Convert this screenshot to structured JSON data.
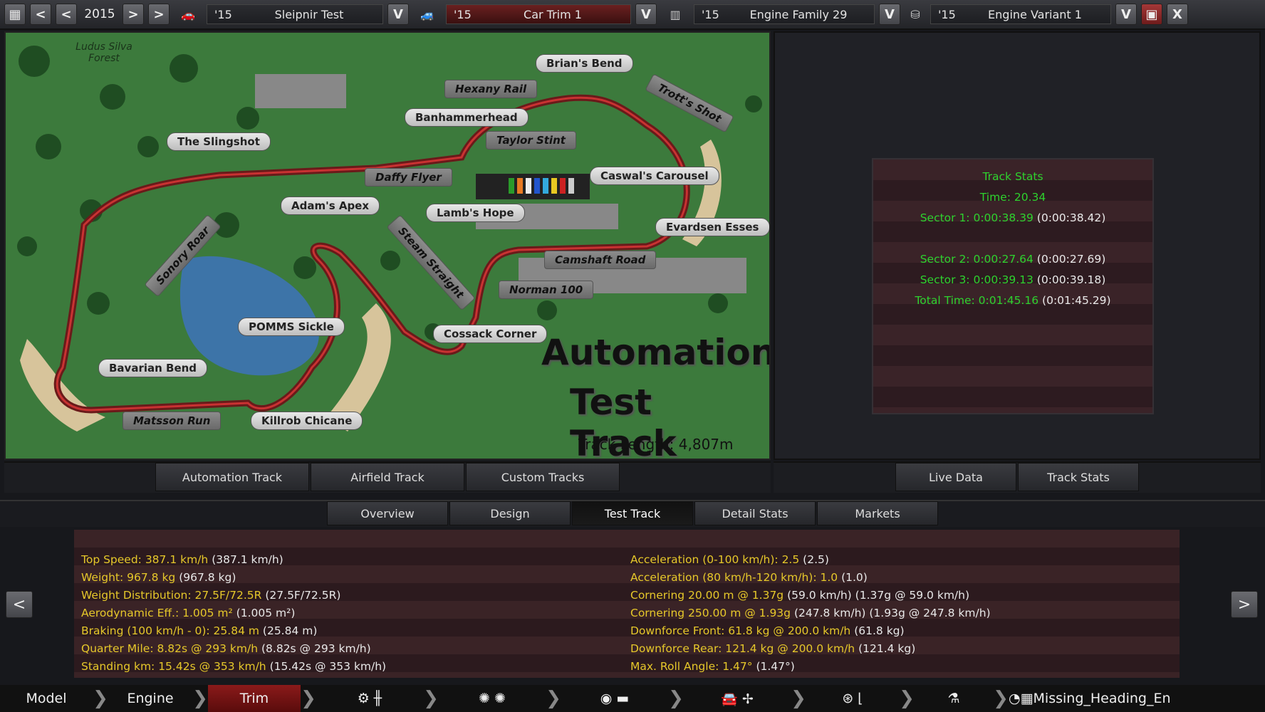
{
  "topbar": {
    "year": "2015",
    "model": {
      "year": "'15",
      "name": "Sleipnir Test"
    },
    "trim": {
      "year": "'15",
      "name": "Car Trim 1"
    },
    "family": {
      "year": "'15",
      "name": "Engine Family 29"
    },
    "variant": {
      "year": "'15",
      "name": "Engine Variant 1"
    },
    "dropdown_glyph": "V",
    "prev_glyph": "<",
    "next_glyph": ">",
    "close_glyph": "X"
  },
  "map": {
    "title_line1": "Automation",
    "title_line2": "Test Track",
    "length": "Track Length: 4,807m",
    "forest": "Ludus Silva Forest",
    "labels": [
      "Brian's Bend",
      "Hexany Rail",
      "Banhammerhead",
      "Trott's Shot",
      "The Slingshot",
      "Taylor Stint",
      "Caswal's Carousel",
      "Daffy Flyer",
      "Adam's Apex",
      "Lamb's Hope",
      "Evardsen Esses",
      "Sonory Roar",
      "Steam Straight",
      "Camshaft Road",
      "Norman 100",
      "POMMS Sickle",
      "Cossack Corner",
      "Bavarian Bend",
      "Matsson Run",
      "Killrob Chicane"
    ]
  },
  "track_tabs": [
    "Automation Track",
    "Airfield Track",
    "Custom Tracks"
  ],
  "right_tabs": [
    "Live Data",
    "Track Stats"
  ],
  "track_stats": {
    "title": "Track Stats",
    "time": "Time: 20.34",
    "sector1": "Sector 1: 0:00:38.39",
    "sector1_pb": "(0:00:38.42)",
    "sector2": "Sector 2: 0:00:27.64",
    "sector2_pb": "(0:00:27.69)",
    "sector3": "Sector 3: 0:00:39.13",
    "sector3_pb": "(0:00:39.18)",
    "total": "Total Time: 0:01:45.16",
    "total_pb": "(0:01:45.29)"
  },
  "sub_tabs": [
    "Overview",
    "Design",
    "Test Track",
    "Detail Stats",
    "Markets"
  ],
  "details_left": [
    {
      "label": "Top Speed: 387.1 km/h",
      "prev": "(387.1 km/h)"
    },
    {
      "label": "Weight: 967.8 kg",
      "prev": "(967.8 kg)"
    },
    {
      "label": "Weight Distribution: 27.5F/72.5R",
      "prev": "(27.5F/72.5R)"
    },
    {
      "label": "Aerodynamic Eff.: 1.005 m²",
      "prev": "(1.005 m²)"
    },
    {
      "label": "Braking (100 km/h - 0): 25.84 m",
      "prev": "(25.84 m)"
    },
    {
      "label": "Quarter Mile: 8.82s @ 293 km/h",
      "prev": "(8.82s @ 293 km/h)"
    },
    {
      "label": "Standing km: 15.42s @ 353 km/h",
      "prev": "(15.42s @ 353 km/h)"
    }
  ],
  "details_right": [
    {
      "label": "Acceleration (0-100 km/h): 2.5",
      "prev": "(2.5)"
    },
    {
      "label": "Acceleration (80 km/h-120 km/h): 1.0",
      "prev": "(1.0)"
    },
    {
      "label": "Cornering 20.00 m @ 1.37g",
      "prev": "(59.0 km/h) (1.37g @ 59.0 km/h)"
    },
    {
      "label": "Cornering 250.00 m @ 1.93g",
      "prev": "(247.8 km/h) (1.93g @ 247.8 km/h)"
    },
    {
      "label": "Downforce Front: 61.8 kg @ 200.0 km/h",
      "prev": "(61.8 kg)"
    },
    {
      "label": "Downforce Rear: 121.4 kg @ 200.0 km/h",
      "prev": "(121.4 kg)"
    },
    {
      "label": "Max. Roll Angle: 1.47°",
      "prev": "(1.47°)"
    }
  ],
  "nav": {
    "model": "Model",
    "engine": "Engine",
    "trim": "Trim",
    "missing": "Missing_Heading_Eng"
  },
  "colors": {
    "stat_green": "#2ed22e",
    "detail_yellow": "#e6c82a",
    "active_red": "#8a1a1a"
  }
}
